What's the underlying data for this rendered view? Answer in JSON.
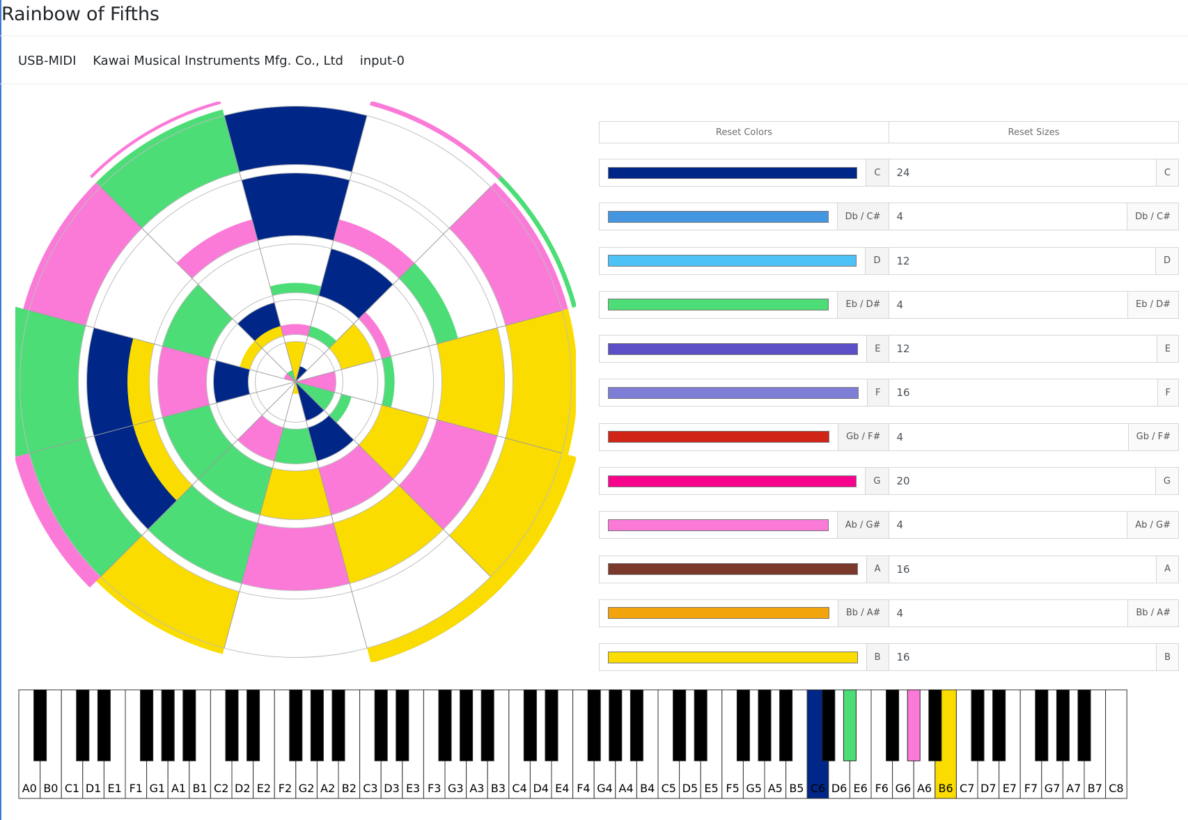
{
  "title": "Rainbow of Fifths",
  "device": {
    "type": "USB-MIDI",
    "manufacturer": "Kawai Musical Instruments Mfg. Co., Ltd",
    "input": "input-0"
  },
  "buttons": {
    "reset_colors": "Reset Colors",
    "reset_sizes": "Reset Sizes"
  },
  "notes": [
    {
      "name": "C",
      "color": "#002787",
      "size": "24"
    },
    {
      "name": "Db / C#",
      "color": "#4496e0",
      "size": "4"
    },
    {
      "name": "D",
      "color": "#4dc2f7",
      "size": "12"
    },
    {
      "name": "Eb / D#",
      "color": "#4cdd76",
      "size": "4"
    },
    {
      "name": "E",
      "color": "#5b4ec6",
      "size": "12"
    },
    {
      "name": "F",
      "color": "#7f7ed6",
      "size": "16"
    },
    {
      "name": "Gb / F#",
      "color": "#d02417",
      "size": "4"
    },
    {
      "name": "G",
      "color": "#f8048c",
      "size": "20"
    },
    {
      "name": "Ab / G#",
      "color": "#fb7ad8",
      "size": "4"
    },
    {
      "name": "A",
      "color": "#7b392b",
      "size": "16"
    },
    {
      "name": "Bb / A#",
      "color": "#f2a40d",
      "size": "4"
    },
    {
      "name": "B",
      "color": "#fadc00",
      "size": "16"
    }
  ],
  "wheel": {
    "ring_colors": {
      "navy": "#002787",
      "pink": "#fb7ad8",
      "green": "#4cdd76",
      "yellow": "#fadc00"
    },
    "segments": [
      {
        "sector": 0,
        "ring": 0,
        "level": 1,
        "color": "yellow"
      },
      {
        "sector": 1,
        "ring": 0,
        "level": 0.4,
        "color": "navy"
      },
      {
        "sector": 3,
        "ring": 0,
        "level": 1,
        "color": "pink"
      },
      {
        "sector": 4,
        "ring": 0,
        "level": 1,
        "color": "green"
      },
      {
        "sector": 5,
        "ring": 0,
        "level": 1,
        "color": "navy"
      },
      {
        "sector": 6,
        "ring": 0,
        "level": 0.3,
        "color": "yellow"
      },
      {
        "sector": 10,
        "ring": 0,
        "level": 0.3,
        "color": "pink"
      },
      {
        "sector": 11,
        "ring": 0,
        "level": 0.3,
        "color": "green"
      },
      {
        "sector": 0,
        "ring": 1,
        "level": 0.3,
        "color": "pink"
      },
      {
        "sector": 1,
        "ring": 1,
        "level": 0.3,
        "color": "green"
      },
      {
        "sector": 2,
        "ring": 1,
        "level": 1,
        "color": "yellow"
      },
      {
        "sector": 4,
        "ring": 1,
        "level": 0.3,
        "color": "green"
      },
      {
        "sector": 5,
        "ring": 1,
        "level": 1,
        "color": "navy"
      },
      {
        "sector": 6,
        "ring": 1,
        "level": 1,
        "color": "green"
      },
      {
        "sector": 7,
        "ring": 1,
        "level": 1,
        "color": "pink"
      },
      {
        "sector": 9,
        "ring": 1,
        "level": 1,
        "color": "navy"
      },
      {
        "sector": 10,
        "ring": 1,
        "level": 0.3,
        "color": "yellow"
      },
      {
        "sector": 11,
        "ring": 1,
        "level": 1,
        "color": "navy"
      },
      {
        "sector": 11,
        "ring": 1,
        "level": 0.3,
        "color": "yellow"
      },
      {
        "sector": 0,
        "ring": 2,
        "level": 0.2,
        "color": "green"
      },
      {
        "sector": 1,
        "ring": 2,
        "level": 1,
        "color": "navy"
      },
      {
        "sector": 2,
        "ring": 2,
        "level": 0.2,
        "color": "pink"
      },
      {
        "sector": 3,
        "ring": 2,
        "level": 0.2,
        "color": "green"
      },
      {
        "sector": 4,
        "ring": 2,
        "level": 1,
        "color": "yellow"
      },
      {
        "sector": 5,
        "ring": 2,
        "level": 1,
        "color": "pink"
      },
      {
        "sector": 6,
        "ring": 2,
        "level": 0.3,
        "color": "navy"
      },
      {
        "sector": 6,
        "ring": 2,
        "level": 1,
        "color": "yellow"
      },
      {
        "sector": 7,
        "ring": 2,
        "level": 1,
        "color": "green"
      },
      {
        "sector": 8,
        "ring": 2,
        "level": 1,
        "color": "green"
      },
      {
        "sector": 9,
        "ring": 2,
        "level": 1,
        "color": "pink"
      },
      {
        "sector": 10,
        "ring": 2,
        "level": 1,
        "color": "green"
      },
      {
        "sector": 0,
        "ring": 3,
        "level": 1,
        "color": "navy"
      },
      {
        "sector": 1,
        "ring": 3,
        "level": 0.35,
        "color": "pink"
      },
      {
        "sector": 2,
        "ring": 3,
        "level": 0.35,
        "color": "green"
      },
      {
        "sector": 3,
        "ring": 3,
        "level": 1,
        "color": "yellow"
      },
      {
        "sector": 4,
        "ring": 3,
        "level": 1,
        "color": "pink"
      },
      {
        "sector": 5,
        "ring": 3,
        "level": 0.35,
        "color": "navy"
      },
      {
        "sector": 5,
        "ring": 3,
        "level": 1,
        "color": "yellow"
      },
      {
        "sector": 6,
        "ring": 3,
        "level": 1,
        "color": "pink"
      },
      {
        "sector": 7,
        "ring": 3,
        "level": 1,
        "color": "green"
      },
      {
        "sector": 8,
        "ring": 3,
        "level": 1,
        "color": "navy"
      },
      {
        "sector": 8,
        "ring": 3,
        "level": 0.35,
        "color": "yellow"
      },
      {
        "sector": 9,
        "ring": 3,
        "level": 1,
        "color": "navy"
      },
      {
        "sector": 9,
        "ring": 3,
        "level": 0.35,
        "color": "yellow"
      },
      {
        "sector": 11,
        "ring": 3,
        "level": 0.35,
        "color": "pink"
      },
      {
        "sector": 0,
        "ring": 4,
        "level": 0.9,
        "color": "navy"
      },
      {
        "sector": 2,
        "ring": 4,
        "level": 1,
        "color": "pink"
      },
      {
        "sector": 3,
        "ring": 4,
        "level": 1,
        "color": "yellow"
      },
      {
        "sector": 4,
        "ring": 4,
        "level": 0.25,
        "color": "navy"
      },
      {
        "sector": 4,
        "ring": 4,
        "level": 1,
        "color": "yellow"
      },
      {
        "sector": 7,
        "ring": 4,
        "level": 0.25,
        "color": "navy"
      },
      {
        "sector": 7,
        "ring": 4,
        "level": 1,
        "color": "yellow"
      },
      {
        "sector": 8,
        "ring": 4,
        "level": 1,
        "color": "green"
      },
      {
        "sector": 9,
        "ring": 4,
        "level": 1,
        "color": "green"
      },
      {
        "sector": 10,
        "ring": 4,
        "level": 1,
        "color": "pink"
      },
      {
        "sector": 11,
        "ring": 4,
        "level": 1,
        "color": "green"
      },
      {
        "sector": 1,
        "ring": 5,
        "level": 0.3,
        "color": "pink"
      },
      {
        "sector": 2,
        "ring": 5,
        "level": 0.3,
        "color": "green"
      },
      {
        "sector": 4,
        "ring": 5,
        "level": 1,
        "color": "yellow"
      },
      {
        "sector": 5,
        "ring": 5,
        "level": 0.08,
        "color": "navy"
      },
      {
        "sector": 5,
        "ring": 5,
        "level": 1,
        "color": "yellow"
      },
      {
        "sector": 8,
        "ring": 5,
        "level": 1,
        "color": "pink"
      },
      {
        "sector": 9,
        "ring": 5,
        "level": 1,
        "color": "green"
      },
      {
        "sector": 11,
        "ring": 5,
        "level": 0.2,
        "color": "pink"
      }
    ]
  },
  "keyboard": {
    "white_keys": [
      "A0",
      "B0",
      "C1",
      "D1",
      "E1",
      "F1",
      "G1",
      "A1",
      "B1",
      "C2",
      "D2",
      "E2",
      "F2",
      "G2",
      "A2",
      "B2",
      "C3",
      "D3",
      "E3",
      "F3",
      "G3",
      "A3",
      "B3",
      "C4",
      "D4",
      "E4",
      "F4",
      "G4",
      "A4",
      "B4",
      "C5",
      "D5",
      "E5",
      "F5",
      "G5",
      "A5",
      "B5",
      "C6",
      "D6",
      "E6",
      "F6",
      "G6",
      "A6",
      "B6",
      "C7",
      "D7",
      "E7",
      "F7",
      "G7",
      "A7",
      "B7",
      "C8"
    ],
    "active_white": {
      "C6": "#002787",
      "B6": "#fadc00"
    },
    "active_black": {
      "D#6": "#4cdd76",
      "G#6": "#fb7ad8"
    }
  }
}
